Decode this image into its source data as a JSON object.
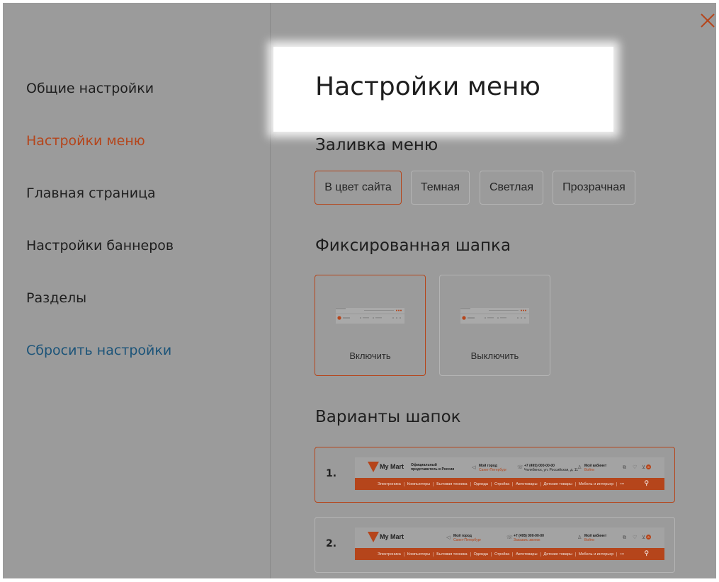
{
  "sidebar": {
    "items": [
      {
        "label": "Общие настройки"
      },
      {
        "label": "Настройки меню"
      },
      {
        "label": "Главная страница"
      },
      {
        "label": "Настройки баннеров"
      },
      {
        "label": "Разделы"
      },
      {
        "label": "Сбросить настройки"
      }
    ],
    "active_index": 1
  },
  "page_title": "Настройки меню",
  "fill_section": {
    "title": "Заливка меню",
    "options": [
      "В цвет сайта",
      "Темная",
      "Светлая",
      "Прозрачная"
    ],
    "selected": "В цвет сайта"
  },
  "fixed_section": {
    "title": "Фиксированная шапка",
    "options": [
      "Включить",
      "Выключить"
    ],
    "selected": "Включить"
  },
  "variants_section": {
    "title": "Варианты шапок",
    "items": [
      {
        "number": "1.",
        "logo": "My Mart",
        "tagline": [
          "Официальный",
          "представитель в России"
        ],
        "city_label": "Мой город",
        "city_value": "Санкт-Петербург",
        "phone": "+7 (495) 000-00-00",
        "address": "Челябинск, ул. Российская, д. 11",
        "account_label": "Мой кабинет",
        "account_value": "Войти",
        "cart_count": "0",
        "nav": [
          "Электроника",
          "Компьютеры",
          "Бытовая техника",
          "Одежда",
          "Стройка",
          "Автотовары",
          "Детские товары",
          "Мебель и интерьер",
          "•••"
        ]
      },
      {
        "number": "2.",
        "logo": "My Mart",
        "city_label": "Мой город",
        "city_value": "Санкт-Петербург",
        "phone": "+7 (495) 000-00-00",
        "phone_sub": "Заказать звонок",
        "account_label": "Мой кабинет",
        "account_value": "Войти",
        "cart_count": "0",
        "nav": [
          "Электроника",
          "Компьютеры",
          "Бытовая техника",
          "Одежда",
          "Стройка",
          "Автотовары",
          "Детские товары",
          "Мебель и интерьер",
          "•••"
        ]
      }
    ],
    "selected_index": 0
  },
  "colors": {
    "accent": "#b5451b",
    "overlay": "#9b9b9b",
    "link": "#1c5479"
  }
}
